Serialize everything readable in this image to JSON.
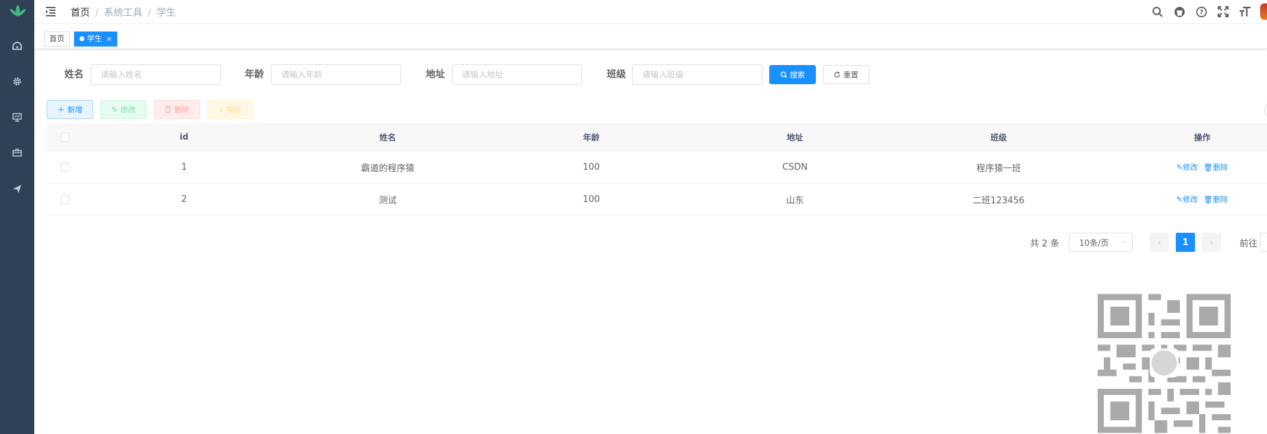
{
  "breadcrumb": [
    "首页",
    "系统工具",
    "学生"
  ],
  "tags": [
    {
      "label": "首页",
      "active": false
    },
    {
      "label": "学生",
      "active": true,
      "close": "×"
    }
  ],
  "search_form": {
    "name": {
      "label": "姓名",
      "placeholder": "请输入姓名"
    },
    "age": {
      "label": "年龄",
      "placeholder": "请输入年龄"
    },
    "address": {
      "label": "地址",
      "placeholder": "请输入地址"
    },
    "class": {
      "label": "班级",
      "placeholder": "请输入班级"
    },
    "search_label": "搜索",
    "reset_label": "重置"
  },
  "toolbar": {
    "add_label": "新增",
    "edit_label": "修改",
    "delete_label": "删除",
    "export_label": "导出"
  },
  "table": {
    "columns": [
      "id",
      "姓名",
      "年龄",
      "地址",
      "班级",
      "操作"
    ],
    "rows": [
      {
        "id": "1",
        "name": "霸道的程序猿",
        "age": "100",
        "address": "CSDN",
        "class": "程序猿一班",
        "edit": "修改",
        "delete": "删除"
      },
      {
        "id": "2",
        "name": "测试",
        "age": "100",
        "address": "山东",
        "class": "二班123456",
        "edit": "修改",
        "delete": "删除"
      }
    ]
  },
  "pagination": {
    "total": "共 2 条",
    "page_size": "10条/页",
    "current_page": "1",
    "goto_label": "前往"
  },
  "colors": {
    "sidebar": "#304156",
    "primary": "#1890ff"
  },
  "icons": {
    "sidebar": [
      "logo-icon",
      "dashboard-icon",
      "gear-icon",
      "monitor-icon",
      "toolbox-icon",
      "send-icon"
    ],
    "navbar": [
      "hamburger-icon",
      "search-icon",
      "github-icon",
      "question-icon",
      "fullscreen-icon",
      "font-size-icon"
    ]
  }
}
